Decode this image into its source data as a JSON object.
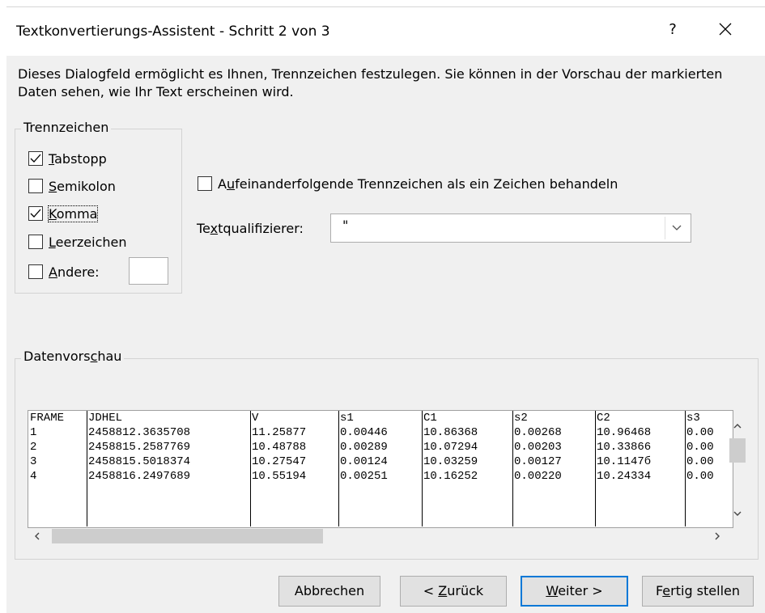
{
  "dialog": {
    "title": "Textkonvertierungs-Assistent - Schritt 2 von 3",
    "help_label": "?",
    "intro_text": "Dieses Dialogfeld ermöglicht es Ihnen, Trennzeichen festzulegen. Sie können in der Vorschau der markierten Daten sehen, wie Ihr Text erscheinen wird."
  },
  "delimiters": {
    "legend": "Trennzeichen",
    "options": [
      {
        "pre": "",
        "u": "T",
        "post": "abstopp",
        "checked": true
      },
      {
        "pre": "",
        "u": "S",
        "post": "emikolon",
        "checked": false
      },
      {
        "pre": "",
        "u": "K",
        "post": "omma",
        "checked": true
      },
      {
        "pre": "",
        "u": "L",
        "post": "eerzeichen",
        "checked": false
      },
      {
        "pre": "",
        "u": "A",
        "post": "ndere:",
        "checked": false
      }
    ],
    "other_value": ""
  },
  "consecutive": {
    "pre": "A",
    "u": "u",
    "post": "feinanderfolgende Trennzeichen als ein Zeichen behandeln",
    "checked": false
  },
  "text_qualifier": {
    "label_pre": "Te",
    "label_u": "x",
    "label_post": "tqualifizierer:",
    "value": "\""
  },
  "preview": {
    "legend_pre": "Datenvors",
    "legend_u": "c",
    "legend_post": "hau",
    "columns": [
      {
        "header": "FRAME",
        "values": [
          "1",
          "2",
          "3",
          "4"
        ]
      },
      {
        "header": "JDHEL",
        "values": [
          "2458812.3635708",
          "2458815.2587769",
          "2458815.5018374",
          "2458816.2497689"
        ]
      },
      {
        "header": "V",
        "values": [
          "11.25877",
          "10.48788",
          "10.27547",
          "10.55194"
        ]
      },
      {
        "header": "s1",
        "values": [
          "0.00446",
          "0.00289",
          "0.00124",
          "0.00251"
        ]
      },
      {
        "header": "C1",
        "values": [
          "10.86368",
          "10.07294",
          "10.03259",
          "10.16252"
        ]
      },
      {
        "header": "s2",
        "values": [
          "0.00268",
          "0.00203",
          "0.00127",
          "0.00220"
        ]
      },
      {
        "header": "C2",
        "values": [
          "10.96468",
          "10.33866",
          "10.1147б",
          "10.24334"
        ]
      },
      {
        "header": "s3",
        "values": [
          "0.00",
          "0.00",
          "0.00",
          "0.00"
        ]
      }
    ]
  },
  "buttons": {
    "cancel": "Abbrechen",
    "back_pre": "< ",
    "back_u": "Z",
    "back_post": "urück",
    "next_pre": "",
    "next_u": "W",
    "next_post": "eiter >",
    "finish_pre": "F",
    "finish_u": "e",
    "finish_post": "rtig stellen"
  }
}
